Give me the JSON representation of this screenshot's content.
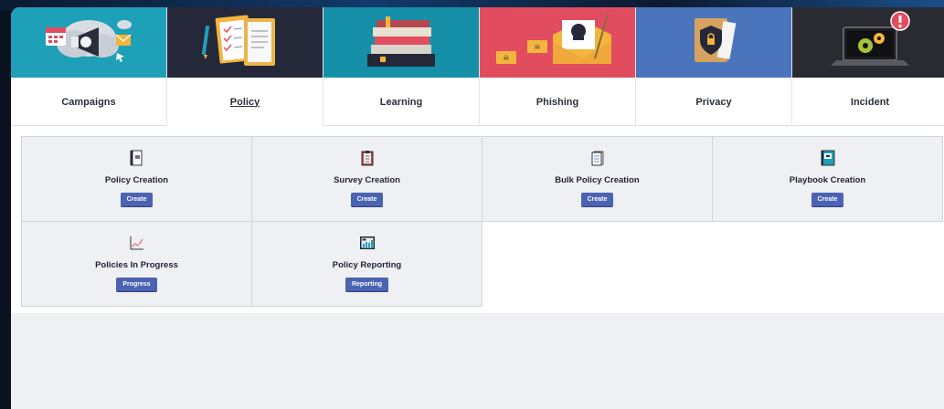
{
  "tabs": [
    {
      "label": "Campaigns",
      "color": "#1ea0b8",
      "active": false,
      "icon": "megaphone-cloud-icon"
    },
    {
      "label": "Policy",
      "color": "#252838",
      "active": true,
      "icon": "clipboard-checklist-icon"
    },
    {
      "label": "Learning",
      "color": "#168fa8",
      "active": false,
      "icon": "books-stack-icon"
    },
    {
      "label": "Phishing",
      "color": "#e14d5f",
      "active": false,
      "icon": "envelope-hook-icon"
    },
    {
      "label": "Privacy",
      "color": "#4a75bd",
      "active": false,
      "icon": "shield-folder-icon"
    },
    {
      "label": "Incident",
      "color": "#2a2a33",
      "active": false,
      "icon": "laptop-alert-icon"
    }
  ],
  "cards": [
    {
      "title": "Policy Creation",
      "button": "Create",
      "icon": "document-flag-icon"
    },
    {
      "title": "Survey Creation",
      "button": "Create",
      "icon": "clipboard-icon"
    },
    {
      "title": "Bulk Policy Creation",
      "button": "Create",
      "icon": "document-list-icon"
    },
    {
      "title": "Playbook Creation",
      "button": "Create",
      "icon": "book-icon"
    },
    {
      "title": "Policies In Progress",
      "button": "Progress",
      "icon": "line-chart-icon"
    },
    {
      "title": "Policy Reporting",
      "button": "Reporting",
      "icon": "report-chart-icon"
    }
  ]
}
